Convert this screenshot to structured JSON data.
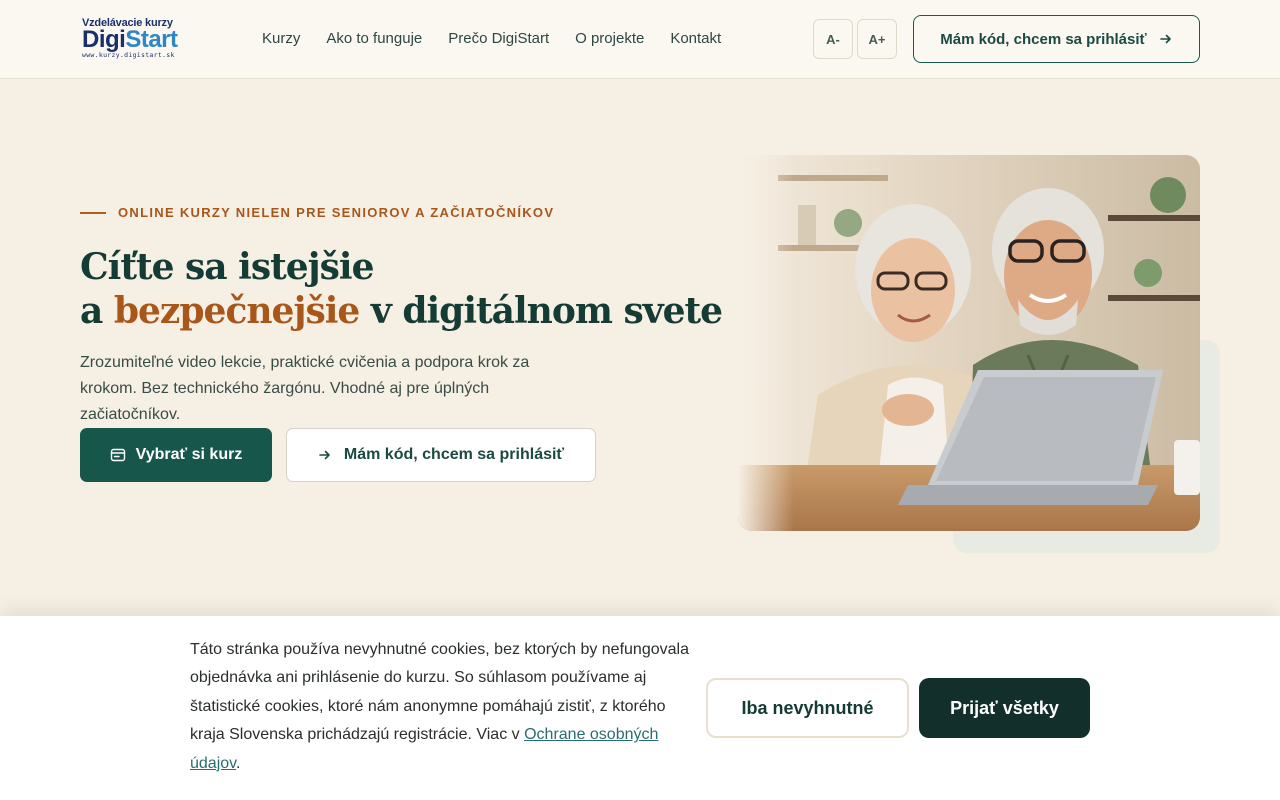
{
  "brand": {
    "line1": "Vzdelávacie kurzy",
    "name_part1": "Digi",
    "name_part2": "Start",
    "url": "www.kurzy.digistart.sk"
  },
  "nav": {
    "items": [
      {
        "label": "Kurzy"
      },
      {
        "label": "Ako to funguje"
      },
      {
        "label": "Prečo DigiStart"
      },
      {
        "label": "O projekte"
      },
      {
        "label": "Kontakt"
      }
    ]
  },
  "font_size": {
    "decrease_label": "A-",
    "increase_label": "A+"
  },
  "header_cta": {
    "label": "Mám kód, chcem sa prihlásiť",
    "icon": "arrow-right-icon"
  },
  "hero": {
    "eyebrow": "ONLINE KURZY NIELEN PRE SENIOROV A ZAČIATOČNÍKOV",
    "title_line1": "Cíťte sa istejšie",
    "title_line2_prefix": "a ",
    "title_line2_accent": "bezpečnejšie",
    "title_line2_suffix": " v digitálnom svete",
    "lede": "Zrozumiteľné video lekcie, praktické cvičenia a podpora krok za krokom. Bez technického žargónu. Vhodné aj pre úplných začiatočníkov.",
    "primary_cta": "Vybrať si kurz",
    "primary_cta_icon": "catalog-icon",
    "secondary_cta": "Mám kód, chcem sa prihlásiť",
    "secondary_cta_icon": "arrow-right-icon",
    "photo_icon": "seniors-with-laptop-photo"
  },
  "cookies": {
    "text": "Táto stránka používa nevyhnutné cookies, bez ktorých by nefungovala objednávka ani prihlásenie do kurzu. So súhlasom používame aj štatistické cookies, ktoré nám anonymne pomáhajú zistiť, z ktorého kraja Slovenska prichádzajú registrácie. Viac v ",
    "link": "Ochrane osobných údajov",
    "text_end": ".",
    "necessary_button": "Iba nevyhnutné",
    "accept_button": "Prijať všetky"
  },
  "colors": {
    "accent_orange": "#a9561a",
    "primary_green": "#17574b",
    "dark_green": "#132f2b",
    "page_background": "#f6efe3"
  }
}
